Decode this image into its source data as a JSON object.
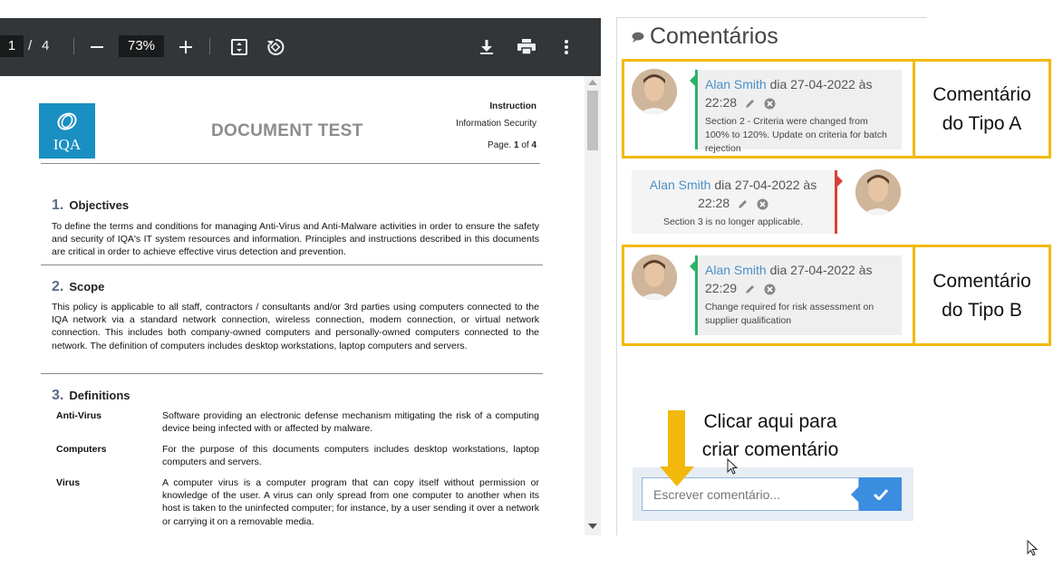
{
  "viewer": {
    "page_current": "1",
    "page_separator": "/",
    "page_total": "4",
    "zoom": "73%",
    "icons": [
      "zoom-out-icon",
      "zoom-in-icon",
      "fit-page-icon",
      "rotate-icon",
      "download-icon",
      "print-icon",
      "more-options-icon"
    ]
  },
  "document": {
    "logo_text": "IQA",
    "title": "DOCUMENT TEST",
    "header_type": "Instruction",
    "header_category": "Information Security",
    "page_label": "Page.",
    "page_num": "1",
    "page_of": "of",
    "page_total": "4",
    "sections": [
      {
        "num": "1.",
        "title": "Objectives",
        "text": "To define the terms and conditions for managing Anti-Virus and Anti-Malware activities in order to ensure the safety and security of IQA's IT system resources and information. Principles and instructions described in this documents are critical in order to achieve effective virus detection and prevention."
      },
      {
        "num": "2.",
        "title": "Scope",
        "text": "This policy is applicable to all staff, contractors / consultants and/or 3rd parties using computers connected to the IQA network via a standard network connection, wireless connection, modem connection, or virtual network connection. This includes both company-owned computers and personally-owned computers connected to the network. The definition of computers includes desktop workstations, laptop computers and servers."
      },
      {
        "num": "3.",
        "title": "Definitions",
        "defs": [
          {
            "term": "Anti-Virus",
            "text": "Software providing an electronic defense mechanism mitigating the risk of a computing device being infected with or affected by malware."
          },
          {
            "term": "Computers",
            "text": "For the purpose of this documents computers includes desktop workstations, laptop computers and servers."
          },
          {
            "term": "Virus",
            "text": "A computer virus is a computer program that can copy itself without permission or knowledge of the user. A virus can only spread from one computer to another when its host is taken to the uninfected computer; for instance, by a user sending it over a network or carrying it on a removable media."
          }
        ]
      }
    ]
  },
  "comments_panel": {
    "heading": "Comentários",
    "comments": [
      {
        "author": "Alan Smith",
        "date_line": "dia 27-04-2022 às",
        "time": "22:28",
        "text": "Section 2 - Criteria were changed from 100% to 120%. Update on criteria for batch rejection",
        "side": "left",
        "accent": "#2db36a"
      },
      {
        "author": "Alan Smith",
        "date_line": "dia 27-04-2022 às",
        "time": "22:28",
        "text": "Section 3 is no longer applicable.",
        "side": "right",
        "accent": "#d9413a"
      },
      {
        "author": "Alan Smith",
        "date_line": "dia 27-04-2022 às",
        "time": "22:29",
        "text": "Change required for risk assessment on supplier qualification",
        "side": "left",
        "accent": "#2db36a"
      }
    ],
    "input_placeholder": "Escrever comentário...",
    "send_icon": "check-icon"
  },
  "annotations": {
    "type_a_line1": "Comentário",
    "type_a_line2": "do Tipo A",
    "type_b_line1": "Comentário",
    "type_b_line2": "do Tipo B",
    "hint_line1": "Clicar aqui para",
    "hint_line2": "criar comentário",
    "highlight_color": "#f2b90c"
  }
}
